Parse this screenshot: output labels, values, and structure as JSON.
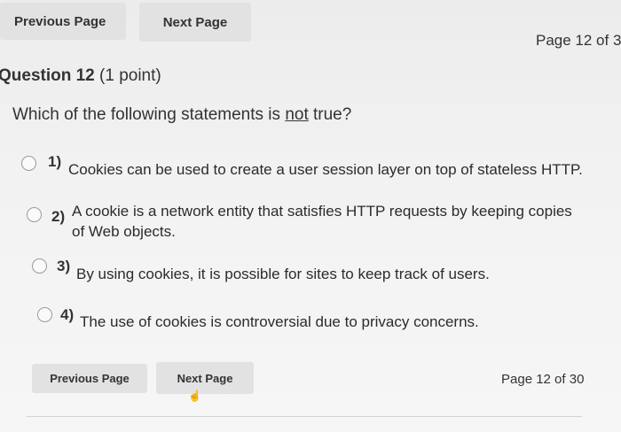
{
  "nav": {
    "prev_label": "Previous Page",
    "next_label": "Next Page",
    "page_indicator_top": "Page 12 of 3",
    "page_indicator_bottom": "Page 12 of 30"
  },
  "question": {
    "title": "Question 12",
    "points": "(1 point)",
    "text_pre": "Which of the following statements is ",
    "text_emph": "not",
    "text_post": " true?"
  },
  "options": [
    {
      "num": "1)",
      "line1": "Cookies can be used to create a user session layer on top of stateless HTTP.",
      "line2": ""
    },
    {
      "num": "2)",
      "line1": "A cookie is a network entity that satisfies HTTP requests by keeping copies",
      "line2": "of Web objects."
    },
    {
      "num": "3)",
      "line1": "By using cookies, it is possible for sites to keep track of users.",
      "line2": ""
    },
    {
      "num": "4)",
      "line1": "The use of cookies is controversial due to privacy concerns.",
      "line2": ""
    }
  ],
  "icons": {
    "cursor": "hand-pointer-icon",
    "radio": "radio-unselected-icon"
  }
}
